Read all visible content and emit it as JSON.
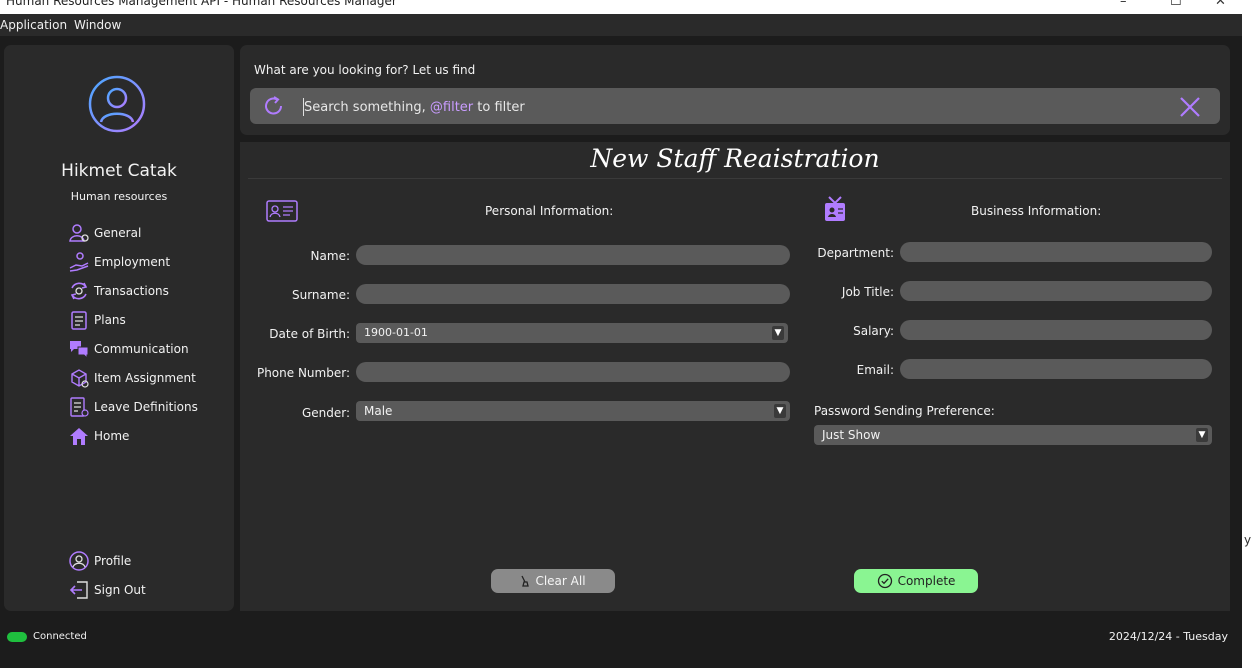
{
  "window": {
    "title": "Human Resources Management API - Human Resources Manager",
    "minimize_glyph": "–",
    "maximize_glyph": "☐",
    "close_glyph": "✕",
    "right_edge_glyph": "y"
  },
  "menu": {
    "items": [
      "Application",
      "Window"
    ]
  },
  "sidebar": {
    "user_name": "Hikmet Catak",
    "user_role": "Human resources",
    "nav": [
      {
        "label": "General",
        "icon": "user-settings-icon"
      },
      {
        "label": "Employment",
        "icon": "hand-user-icon"
      },
      {
        "label": "Transactions",
        "icon": "exchange-gear-icon"
      },
      {
        "label": "Plans",
        "icon": "clipboard-plan-icon"
      },
      {
        "label": "Communication",
        "icon": "chat-bubbles-icon"
      },
      {
        "label": "Item Assignment",
        "icon": "box-assignment-icon"
      },
      {
        "label": "Leave Definitions",
        "icon": "leave-document-icon"
      },
      {
        "label": "Home",
        "icon": "home-icon"
      }
    ],
    "bottom": [
      {
        "label": "Profile",
        "icon": "profile-icon"
      },
      {
        "label": "Sign Out",
        "icon": "sign-out-icon"
      }
    ]
  },
  "search": {
    "prompt": "What are you looking for? Let us find",
    "placeholder_pre": "Search something,",
    "placeholder_filter": "@filter",
    "placeholder_post": "to filter"
  },
  "form": {
    "title": "New Staff Reaistration",
    "personal": {
      "title": "Personal Information:",
      "name_label": "Name:",
      "surname_label": "Surname:",
      "dob_label": "Date of Birth:",
      "dob_value": "1900-01-01",
      "phone_label": "Phone Number:",
      "gender_label": "Gender:",
      "gender_value": "Male"
    },
    "business": {
      "title": "Business Information:",
      "department_label": "Department:",
      "job_title_label": "Job Title:",
      "salary_label": "Salary:",
      "email_label": "Email:",
      "password_pref_label": "Password Sending Preference:",
      "password_pref_value": "Just Show"
    },
    "clear_label": "Clear All",
    "complete_label": "Complete"
  },
  "status": {
    "connection": "Connected",
    "connection_color": "#1fbf3e",
    "date": "2024/12/24 - Tuesday"
  },
  "colors": {
    "accent": "#b07cff",
    "complete_button": "#8af592",
    "clear_button": "#8a8a8a"
  }
}
